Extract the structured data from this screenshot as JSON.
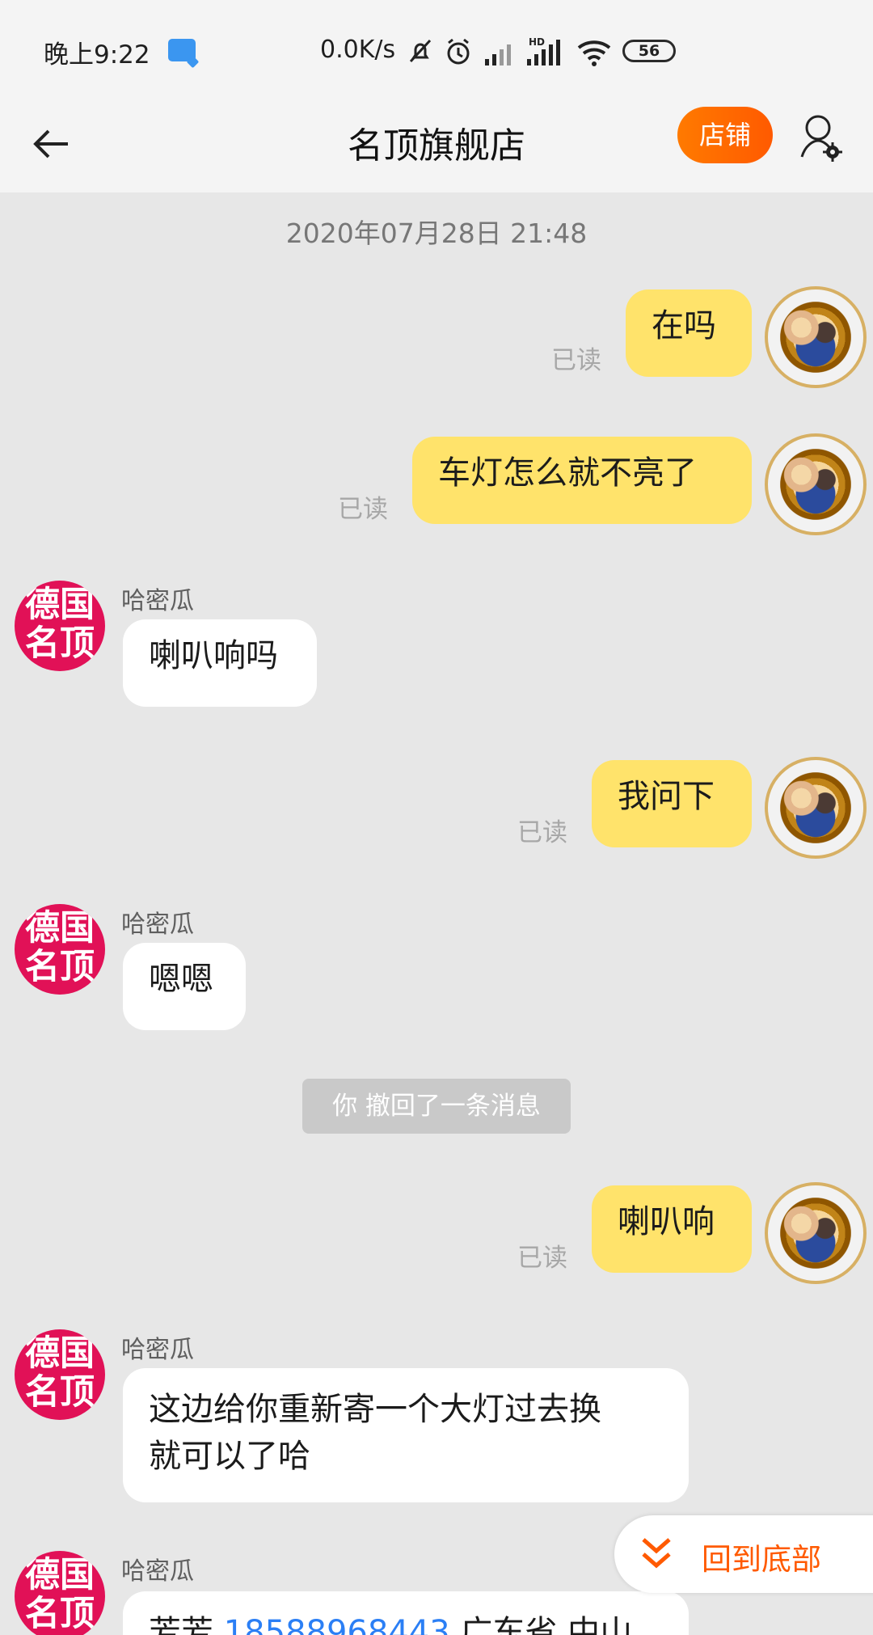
{
  "status_bar": {
    "time": "晚上9:22",
    "network_speed": "0.0K/s",
    "battery": "56"
  },
  "nav": {
    "title": "名顶旗舰店",
    "shop_button": "店铺"
  },
  "chat": {
    "timestamp": "2020年07月28日 21:48",
    "messages": [
      {
        "from": "me",
        "text": "在吗",
        "status": "已读"
      },
      {
        "from": "me",
        "text": "车灯怎么就不亮了",
        "status": "已读"
      },
      {
        "from": "them",
        "sender": "哈密瓜",
        "text": "喇叭响吗"
      },
      {
        "from": "me",
        "text": "我问下",
        "status": "已读"
      },
      {
        "from": "them",
        "sender": "哈密瓜",
        "text": "嗯嗯"
      },
      {
        "from": "system",
        "text": "你 撤回了一条消息"
      },
      {
        "from": "me",
        "text": "喇叭响",
        "status": "已读"
      },
      {
        "from": "them",
        "sender": "哈密瓜",
        "text_lines": [
          "这边给你重新寄一个大灯过去换",
          "就可以了哈"
        ]
      },
      {
        "from": "them",
        "sender": "哈密瓜",
        "text_prefix": "芳芳",
        "phone": "18588968443",
        "text_suffix": "广东省 中山"
      }
    ],
    "avatar_them_text_line1": "德国",
    "avatar_them_text_line2": "名顶"
  },
  "scroll_bottom": {
    "label": "回到底部"
  },
  "colors": {
    "accent_orange": "#ff5a00",
    "my_bubble": "#ffe36b",
    "their_bubble": "#ffffff",
    "shop_avatar_red": "#e11157",
    "phone_link": "#2b7ff5"
  }
}
